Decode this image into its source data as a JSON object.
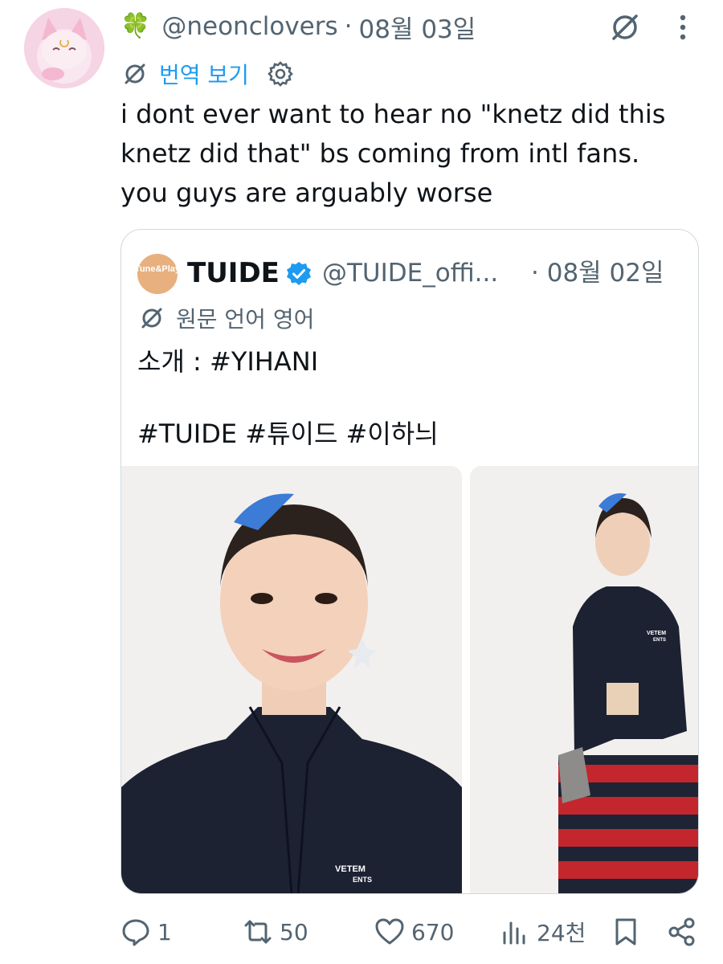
{
  "author": {
    "emoji": "🍀",
    "handle": "@neonclovers",
    "separator": "·",
    "date": "08월 03일"
  },
  "translate": {
    "label": "번역 보기"
  },
  "body_lines": [
    "i dont ever want to hear no \"knetz did this",
    "knetz did that\" bs coming from intl fans.",
    "you guys are arguably worse"
  ],
  "quote": {
    "avatar_text": "Tune&Play",
    "name": "TUIDE",
    "handle": "@TUIDE_offi...",
    "separator": "·",
    "date": "08월 02일",
    "language_note": "원문 언어 영어",
    "text_line1": "소개 : #YIHANI",
    "text_line2": "#TUIDE #튜이드 #이하늬",
    "left_media": {
      "print_text": "VETEM",
      "print_text2": "ENTS"
    },
    "right_media": {
      "print_text": "VETEM",
      "print_text2": "ENTS"
    }
  },
  "actions": {
    "reply_count": "1",
    "retweet_count": "50",
    "like_count": "670",
    "views_count": "24천"
  },
  "colors": {
    "accent": "#1d9bf0",
    "secondary_text": "#536471",
    "primary_text": "#0f1419",
    "border": "#cfd9de"
  }
}
